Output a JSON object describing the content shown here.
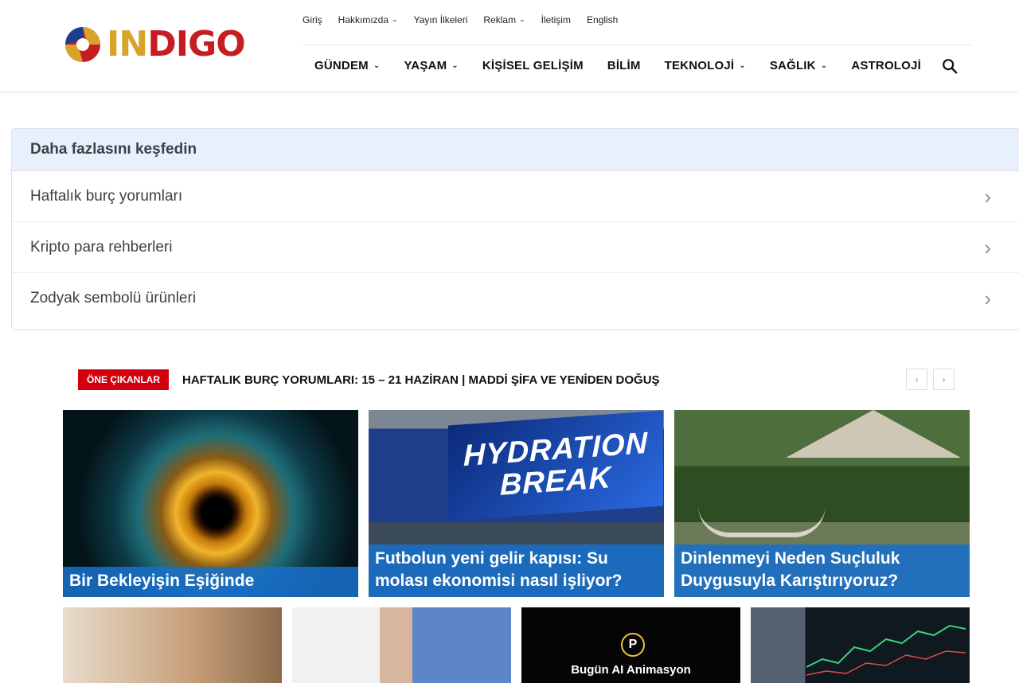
{
  "logo": {
    "text_in": "IN",
    "text_digo": "DIGO"
  },
  "topnav": [
    {
      "label": "Giriş",
      "has_chevron": false
    },
    {
      "label": "Hakkımızda",
      "has_chevron": true
    },
    {
      "label": "Yayın İlkeleri",
      "has_chevron": false
    },
    {
      "label": "Reklam",
      "has_chevron": true
    },
    {
      "label": "İletişim",
      "has_chevron": false
    },
    {
      "label": "English",
      "has_chevron": false
    }
  ],
  "mainnav": [
    {
      "label": "GÜNDEM",
      "has_chevron": true
    },
    {
      "label": "YAŞAM",
      "has_chevron": true
    },
    {
      "label": "KİŞİSEL GELİŞİM",
      "has_chevron": false
    },
    {
      "label": "BİLİM",
      "has_chevron": false
    },
    {
      "label": "TEKNOLOJİ",
      "has_chevron": true
    },
    {
      "label": "SAĞLIK",
      "has_chevron": true
    },
    {
      "label": "ASTROLOJİ",
      "has_chevron": false
    }
  ],
  "discover": {
    "title": "Daha fazlasını keşfedin",
    "items": [
      "Haftalık burç yorumları",
      "Kripto para rehberleri",
      "Zodyak sembolü ürünleri"
    ]
  },
  "ticker": {
    "badge": "ÖNE ÇIKANLAR",
    "headline": "HAFTALIK BURÇ YORUMLARI: 15 – 21 HAZİRAN | MADDİ ŞİFA VE YENİDEN DOĞUŞ",
    "prev": "‹",
    "next": "›"
  },
  "cards": [
    {
      "title": "Bir Bekleyişin Eşiğinde"
    },
    {
      "title": "Futbolun yeni gelir kapısı: Su molası ekonomisi nasıl işliyor?",
      "screen_text_1": "HYDRATION",
      "screen_text_2": "BREAK"
    },
    {
      "title": "Dinlenmeyi Neden Suçluluk Duygusuyla Karıştırıyoruz?"
    }
  ],
  "thumbs": {
    "t3_label": "Bugün AI Animasyon",
    "t3_badge": "P"
  },
  "colors": {
    "accent_blue": "#186ec8",
    "badge_red": "#d2000f",
    "logo_gold": "#d7a32a",
    "logo_red": "#c71c22"
  }
}
